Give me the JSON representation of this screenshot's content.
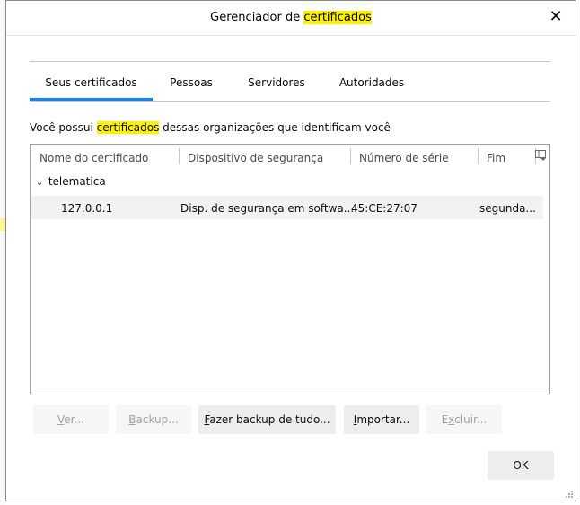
{
  "dialog": {
    "title_prefix": "Gerenciador de ",
    "title_highlight": "certificados",
    "close_glyph": "✕"
  },
  "tabs": [
    {
      "label": "Seus certificados",
      "active": true
    },
    {
      "label": "Pessoas",
      "active": false
    },
    {
      "label": "Servidores",
      "active": false
    },
    {
      "label": "Autoridades",
      "active": false
    }
  ],
  "description": {
    "prefix": "Você possui ",
    "highlight": "certificados",
    "suffix": " dessas organizações que identificam você"
  },
  "table": {
    "columns": [
      "Nome do certificado",
      "Dispositivo de segurança",
      "Número de série",
      "Fim"
    ],
    "group": {
      "twisty": "⌄",
      "label": "telematica"
    },
    "rows": [
      {
        "name": "127.0.0.1",
        "device": "Disp. de segurança em softwa...",
        "serial": "45:CE:27:07",
        "end": "segunda..."
      }
    ]
  },
  "buttons": {
    "view": {
      "accesskey": "V",
      "rest": "er...",
      "disabled": true
    },
    "backup": {
      "accesskey": "B",
      "rest": "ackup...",
      "disabled": true
    },
    "backup_all": {
      "accesskey": "F",
      "rest": "azer backup de tudo...",
      "disabled": false
    },
    "import": {
      "accesskey": "I",
      "rest": "mportar...",
      "disabled": false
    },
    "delete": {
      "pre": "E",
      "accesskey": "x",
      "rest": "cluir...",
      "disabled": true
    },
    "ok": "OK"
  },
  "colors": {
    "highlight": "#fff200",
    "accent": "#0a84ff"
  }
}
